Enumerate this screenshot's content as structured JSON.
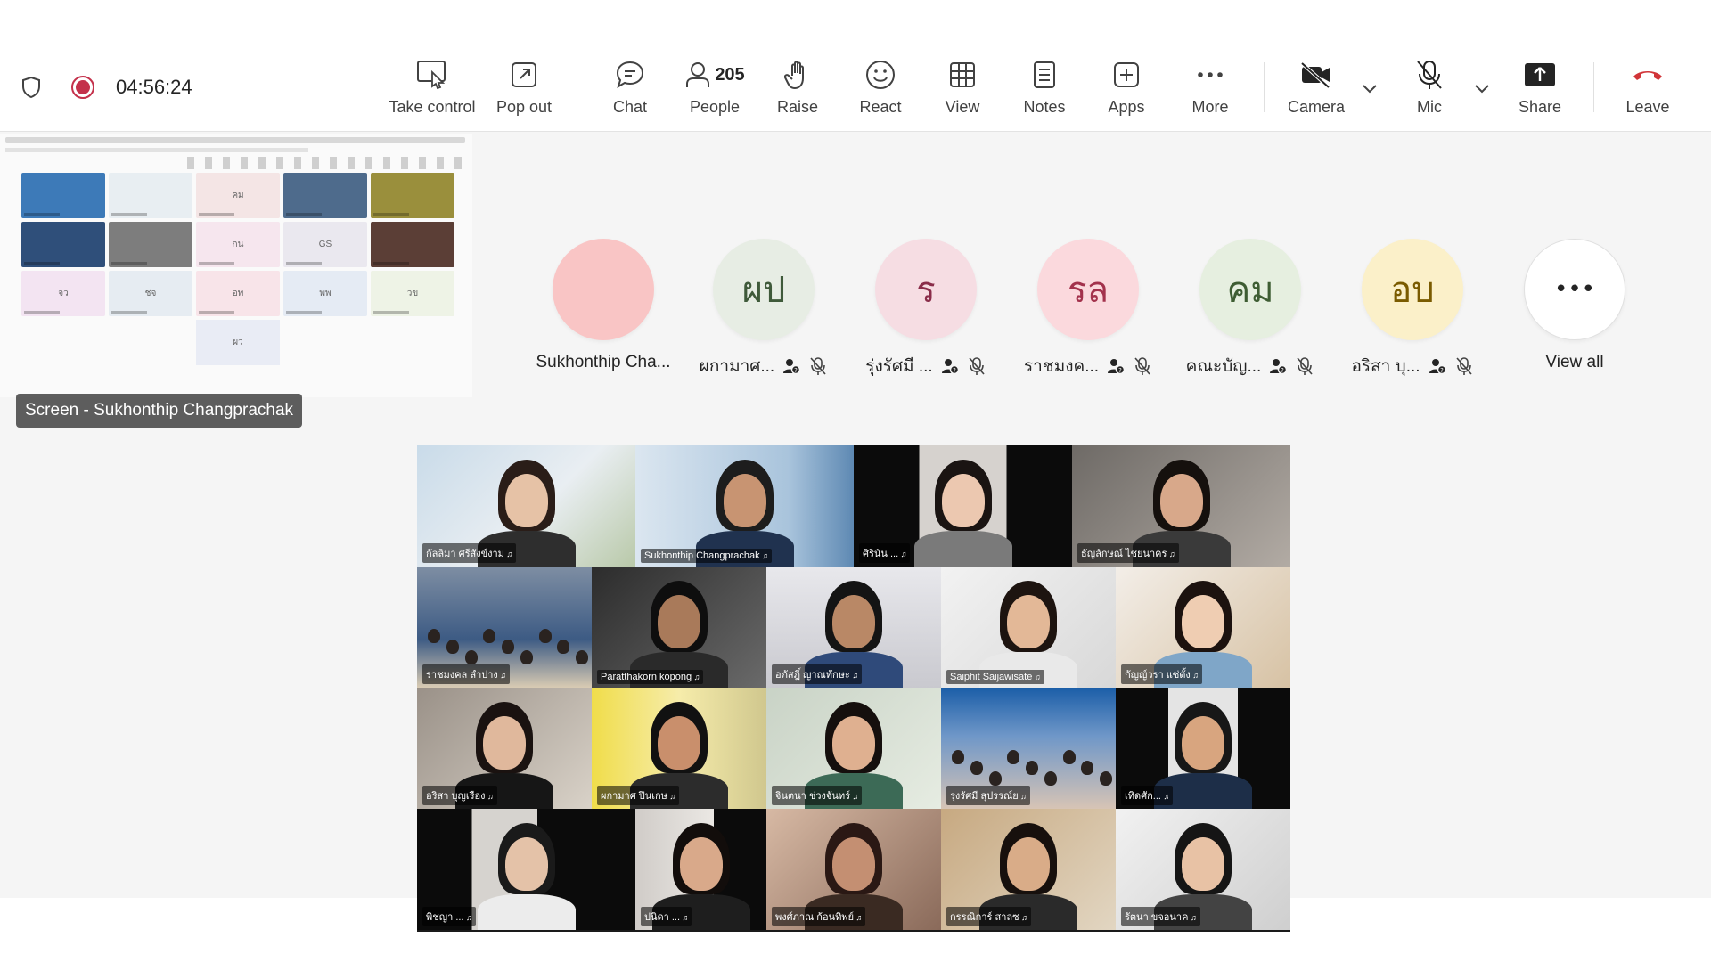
{
  "meeting": {
    "timer": "04:56:24",
    "people_count": "205"
  },
  "toolbar": {
    "take_control": "Take control",
    "pop_out": "Pop out",
    "chat": "Chat",
    "people": "People",
    "raise": "Raise",
    "react": "React",
    "view": "View",
    "notes": "Notes",
    "apps": "Apps",
    "more": "More",
    "camera": "Camera",
    "mic": "Mic",
    "share": "Share",
    "leave": "Leave"
  },
  "screen_share": {
    "caption": "Screen - Sukhonthip Changprachak"
  },
  "participants": [
    {
      "initials": "",
      "name": "Sukhonthip Cha...",
      "bg": "#f9c5c5",
      "fg": "#c4314b"
    },
    {
      "initials": "ผป",
      "name": "ผกามาศ...",
      "bg": "#e7ede4",
      "fg": "#3f5a3a"
    },
    {
      "initials": "ร",
      "name": "รุ่งรัศมี ...",
      "bg": "#f6dde3",
      "fg": "#8a2d4a"
    },
    {
      "initials": "รล",
      "name": "ราชมงค...",
      "bg": "#fbd9dd",
      "fg": "#a3324c"
    },
    {
      "initials": "คม",
      "name": "คณะบัญ...",
      "bg": "#e6efe0",
      "fg": "#3e5d33"
    },
    {
      "initials": "อบ",
      "name": "อริสา บุ...",
      "bg": "#fbf0c9",
      "fg": "#7a5b00"
    },
    {
      "initials": "•••",
      "name": "View all",
      "bg": "#ffffff",
      "fg": "#242424"
    }
  ],
  "video_names": {
    "r1": [
      "กัลลิมา ศรีสังข์งาม",
      "Sukhonthip Changprachak",
      "ศิรินัน ...",
      "ธัญลักษณ์ ไชยนาคร"
    ],
    "r2": [
      "ราชมงคล ลำปาง",
      "Paratthakorn kopong",
      "อภัสฎิ์ ญาณทักษะ",
      "Saiphit Saijawisate",
      "กัญญ์วรา แซ่ตั้ง"
    ],
    "r3": [
      "อริสา บุญเรือง",
      "ผกามาศ ปินเกษ",
      "จินตนา ช่วงจันทร์",
      "รุ่งรัศมี สุปรรณ์ย",
      "เทิดศัก..."
    ],
    "r4": [
      "พิชญา ...",
      "ปนิดา ...",
      "พงศ์ภาณ ก้อนทิพย์",
      "กรรณิการ์ สาลซ",
      "รัตนา ขจอนาค"
    ]
  },
  "colors": {
    "record_red": "#c4314b",
    "leave_red": "#d13438",
    "stage_bg": "#f5f5f5"
  }
}
